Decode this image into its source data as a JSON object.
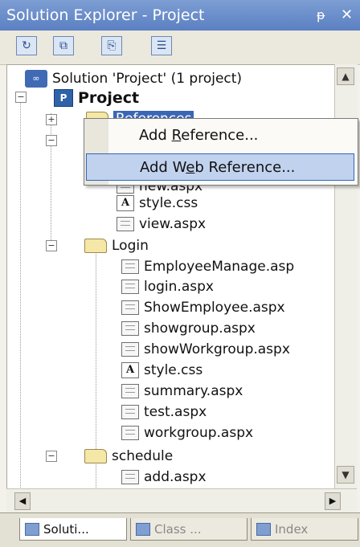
{
  "window": {
    "title": "Solution Explorer - Project",
    "pin": "ᵽ",
    "close": "✕"
  },
  "toolbar": {
    "buttons": [
      "↻",
      "⧉",
      "⎘",
      "☰"
    ]
  },
  "tree": {
    "solution": "Solution 'Project' (1 project)",
    "project": "Project",
    "references": "References",
    "hidden_item": "new.aspx",
    "files_top": [
      "style.css",
      "view.aspx"
    ],
    "login_folder": "Login",
    "login_files": [
      "EmployeeManage.asp",
      "login.aspx",
      "ShowEmployee.aspx",
      "showgroup.aspx",
      "showWorkgroup.aspx",
      "style.css",
      "summary.aspx",
      "test.aspx",
      "workgroup.aspx"
    ],
    "schedule_folder": "schedule",
    "schedule_files": [
      "add.aspx"
    ]
  },
  "context_menu": {
    "items": [
      {
        "pre": "Add ",
        "key": "R",
        "post": "eference..."
      },
      {
        "pre": "Add W",
        "key": "e",
        "post": "b Reference..."
      }
    ]
  },
  "tabs": [
    "Soluti...",
    "Class ...",
    "Index"
  ]
}
